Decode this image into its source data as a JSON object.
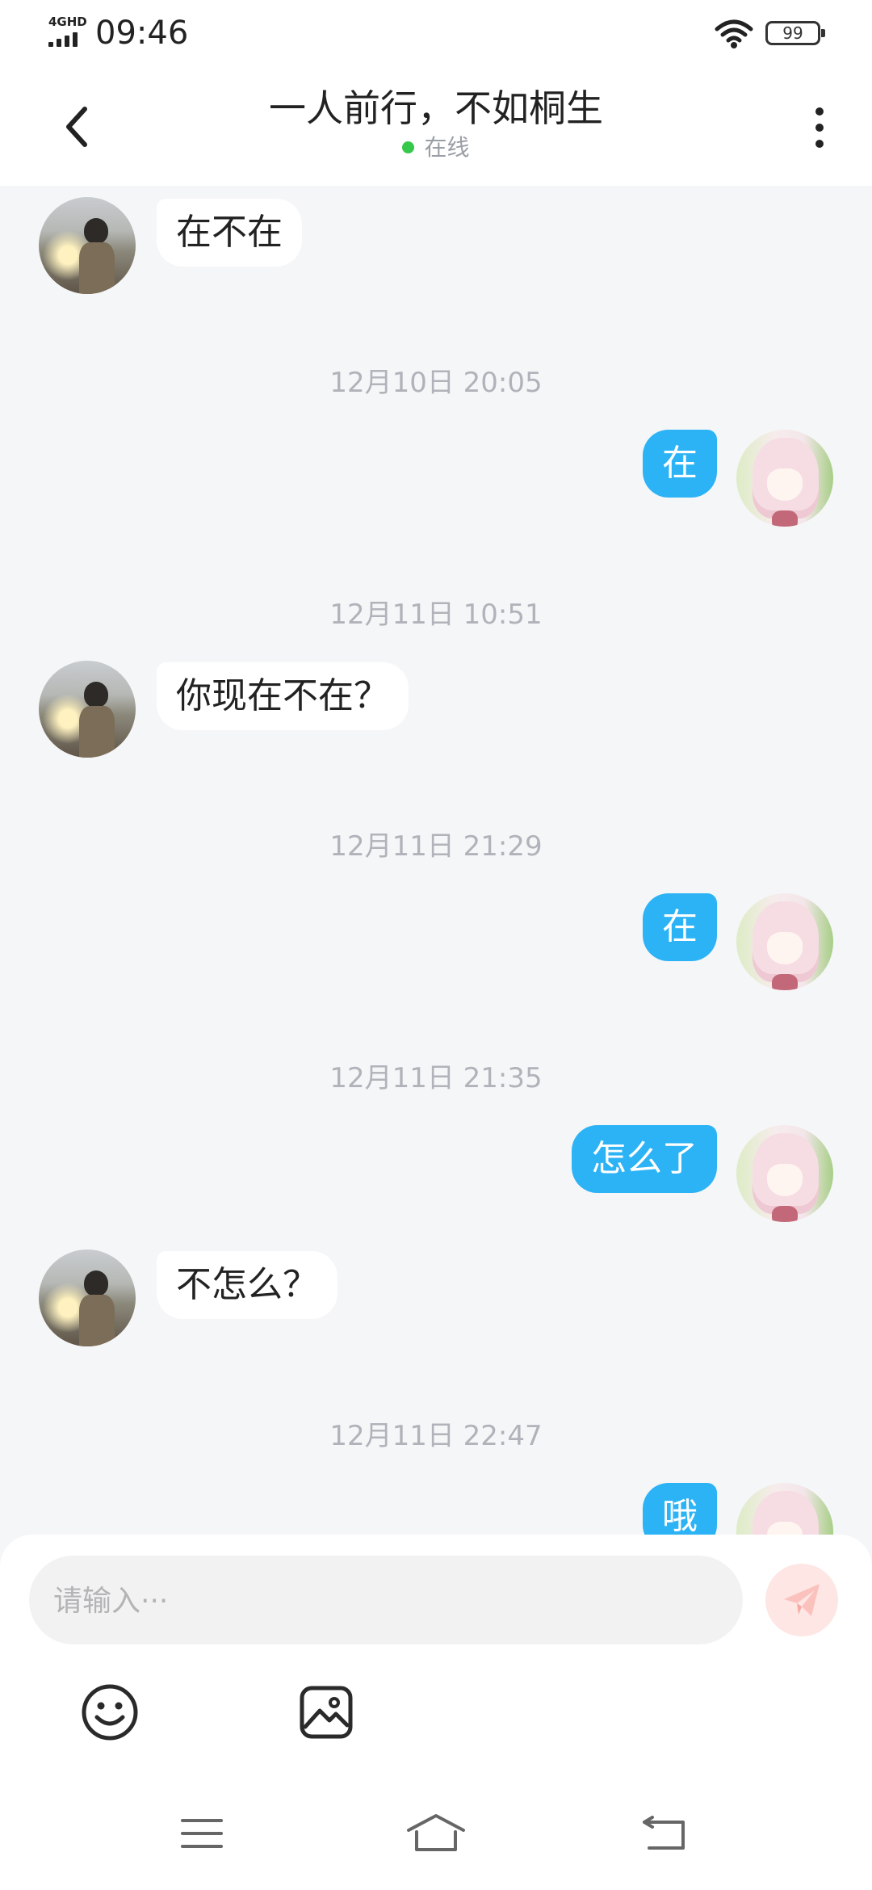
{
  "status_bar": {
    "network": "4GHD",
    "time": "09:46",
    "battery": "99",
    "icons": [
      "signal-icon",
      "wifi-icon",
      "battery-icon"
    ]
  },
  "header": {
    "title": "一人前行，不如桐生",
    "presence": "在线",
    "presence_color": "#35c84a",
    "icons": [
      "back-arrow-icon",
      "more-vertical-icon"
    ]
  },
  "timestamps": [
    "12月10日 20:05",
    "12月11日 10:51",
    "12月11日 21:29",
    "12月11日 21:35",
    "12月11日 22:47"
  ],
  "messages": [
    {
      "from": "contact",
      "text": "在不在"
    },
    {
      "from": "me",
      "text": "在"
    },
    {
      "from": "contact",
      "text": "你现在不在？"
    },
    {
      "from": "me",
      "text": "在"
    },
    {
      "from": "me",
      "text": "怎么了"
    },
    {
      "from": "contact",
      "text": "不怎么？"
    },
    {
      "from": "me",
      "text": "哦"
    }
  ],
  "composer": {
    "placeholder": "请输入···",
    "value": "",
    "icons": [
      "send-icon",
      "emoji-icon",
      "image-icon"
    ]
  },
  "nav_bar": {
    "icons": [
      "menu-icon",
      "home-icon",
      "back-icon"
    ]
  },
  "colors": {
    "accent": "#2cb3f5",
    "background": "#f5f6f8",
    "send_button": "#fde6e4",
    "timestamp": "#b0b3b9"
  }
}
